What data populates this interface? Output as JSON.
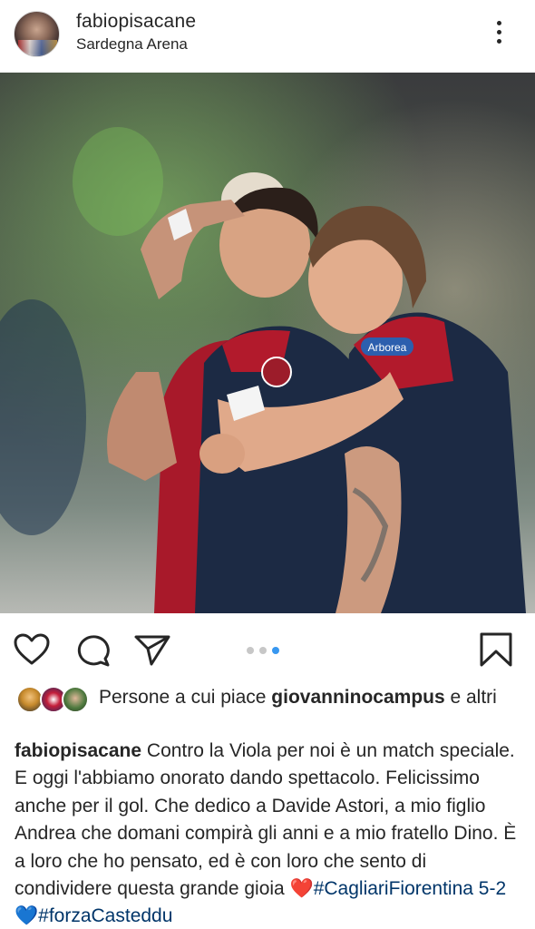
{
  "post": {
    "username": "fabiopisacane",
    "location": "Sardegna Arena",
    "more_icon": "more-vertical-icon",
    "photo_description_icon": "post-photo",
    "shirt_sponsor": "Arborea",
    "carousel": {
      "total": 3,
      "active_index": 2
    }
  },
  "actions": {
    "like_icon": "heart-icon",
    "comment_icon": "comment-icon",
    "share_icon": "paper-plane-icon",
    "save_icon": "bookmark-icon"
  },
  "likes": {
    "prefix": "Persone a cui piace ",
    "user": "giovanninocampus",
    "suffix": " e altri"
  },
  "caption": {
    "author": "fabiopisacane",
    "text_1": " Contro la Viola per noi è un match speciale. E oggi l'abbiamo onorato dando spettacolo. Felicissimo anche per il gol. Che dedico a Davide Astori, a mio figlio Andrea che domani compirà gli anni e a mio fratello Dino. È a loro che ho pensato, ed è con loro che sento di condividere questa grande gioia ",
    "emoji_heart_red": "❤️",
    "hashtag_1": "#CagliariFiorentina",
    "score": " 5-2 ",
    "emoji_heart_blue": "💙",
    "hashtag_2": "#forzaCasteddu"
  },
  "colors": {
    "text": "#262626",
    "active_dot": "#3897f0",
    "inactive_dot": "#c7c7c7",
    "hashtag": "#003569"
  }
}
